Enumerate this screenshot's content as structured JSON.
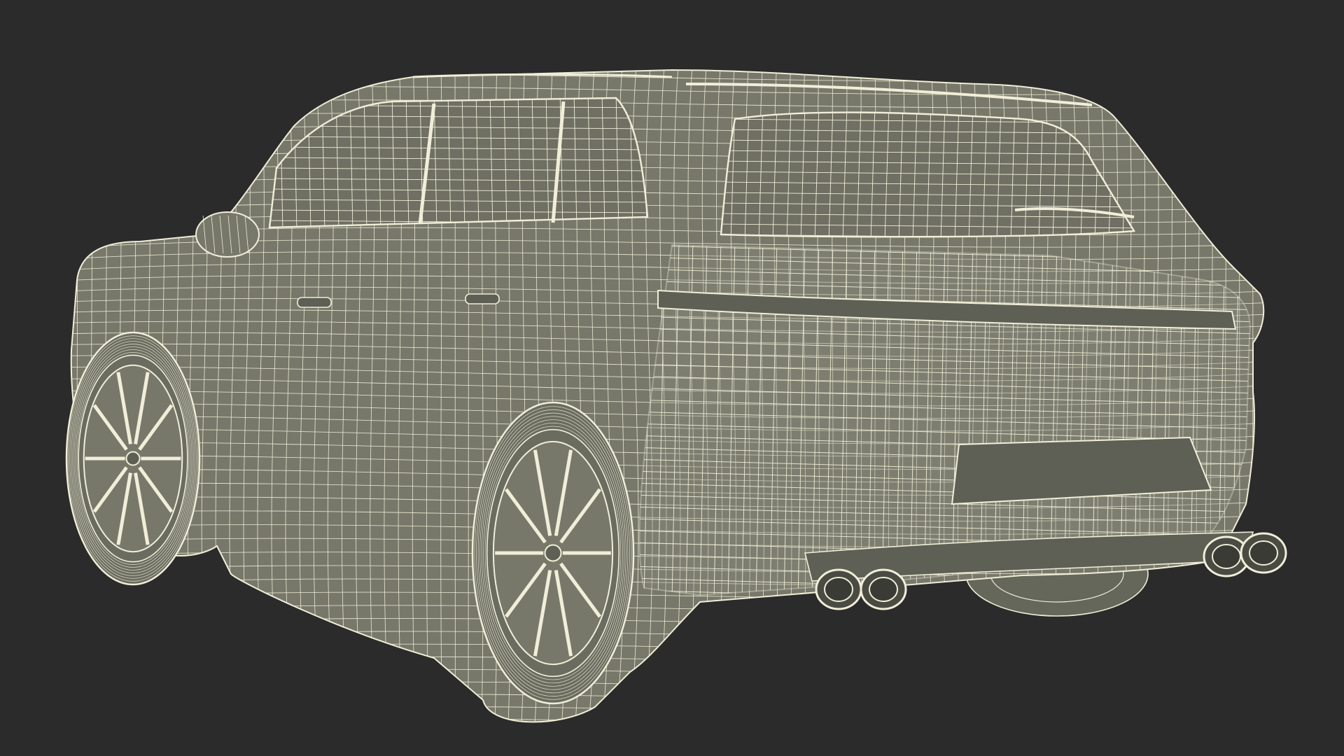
{
  "scene": {
    "subject": "suv-wireframe-render",
    "view": "rear-three-quarter",
    "colors": {
      "background": "#2b2b2b",
      "surface": "#77786a",
      "surface_light": "#8a8b7c",
      "surface_dark": "#5f6055",
      "wire": "#f0eed8",
      "glass": "#6f7063",
      "tire": "#6b6c60"
    }
  }
}
